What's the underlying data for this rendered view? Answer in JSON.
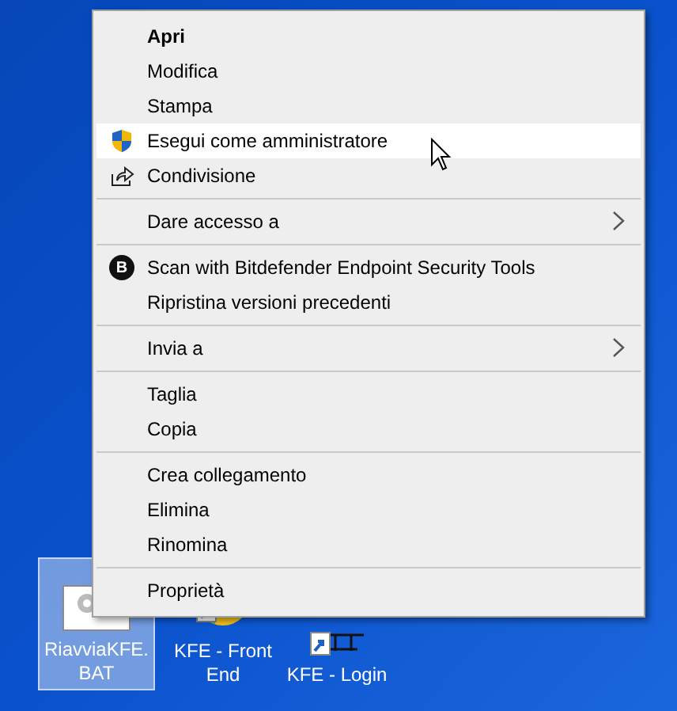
{
  "desktop_icons": [
    {
      "label": "RiavviaKFE.BAT",
      "selected": true,
      "kind": "batch"
    },
    {
      "label": "KFE - Front End",
      "selected": false,
      "kind": "shortcut-round"
    },
    {
      "label": "KFE - Login",
      "selected": false,
      "kind": "shortcut-bars"
    }
  ],
  "context_menu": {
    "items": [
      {
        "kind": "plain",
        "label": "Apri",
        "bold": true,
        "selected": false
      },
      {
        "kind": "plain",
        "label": "Modifica",
        "bold": false,
        "selected": false
      },
      {
        "kind": "plain",
        "label": "Stampa",
        "bold": false,
        "selected": false
      },
      {
        "kind": "shield",
        "label": "Esegui come amministratore",
        "bold": false,
        "selected": true
      },
      {
        "kind": "share",
        "label": "Condivisione",
        "bold": false,
        "selected": false
      },
      {
        "kind": "separator"
      },
      {
        "kind": "submenu",
        "label": "Dare accesso a",
        "bold": false,
        "selected": false
      },
      {
        "kind": "separator"
      },
      {
        "kind": "letter",
        "label": "Scan with Bitdefender Endpoint Security Tools",
        "bold": false,
        "selected": false,
        "icon_text": "B"
      },
      {
        "kind": "plain",
        "label": "Ripristina versioni precedenti",
        "bold": false,
        "selected": false
      },
      {
        "kind": "separator"
      },
      {
        "kind": "submenu",
        "label": "Invia a",
        "bold": false,
        "selected": false
      },
      {
        "kind": "separator"
      },
      {
        "kind": "plain",
        "label": "Taglia",
        "bold": false,
        "selected": false
      },
      {
        "kind": "plain",
        "label": "Copia",
        "bold": false,
        "selected": false
      },
      {
        "kind": "separator"
      },
      {
        "kind": "plain",
        "label": "Crea collegamento",
        "bold": false,
        "selected": false
      },
      {
        "kind": "plain",
        "label": "Elimina",
        "bold": false,
        "selected": false
      },
      {
        "kind": "plain",
        "label": "Rinomina",
        "bold": false,
        "selected": false
      },
      {
        "kind": "separator"
      },
      {
        "kind": "plain",
        "label": "Proprietà",
        "bold": false,
        "selected": false
      }
    ]
  }
}
